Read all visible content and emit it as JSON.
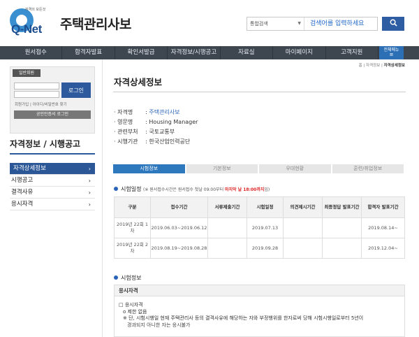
{
  "header": {
    "logo_sub": "자격의 모든것",
    "logo_text": "Q-Net",
    "site_title": "주택관리사보",
    "search_scope": "통합검색",
    "search_placeholder": "검색어를 입력하세요",
    "search_icon": "magnifier-icon"
  },
  "nav": {
    "items": [
      "원서접수",
      "합격자발표",
      "확인서발급",
      "자격정보/시행공고",
      "자료실",
      "마이페이지",
      "고객지원"
    ],
    "all_menu": "전체메뉴"
  },
  "login": {
    "title": "일반회원",
    "button": "로그인",
    "links": "회원가입 | 아이디/비밀번호 찾기",
    "cert_button": "공인인증서 로그인"
  },
  "sidebar": {
    "section_title": "자격정보 / 시행공고",
    "items": [
      {
        "label": "자격상세정보",
        "active": true
      },
      {
        "label": "시행공고"
      },
      {
        "label": "결격사유"
      },
      {
        "label": "응시자격"
      }
    ]
  },
  "content": {
    "breadcrumb_home": "홈",
    "breadcrumb_mid": "자격정보",
    "breadcrumb_current": "자격상세정보",
    "page_title": "자격상세정보",
    "info": {
      "name_label": "자격명",
      "name_value": "주택관리사보",
      "eng_label": "영문명",
      "eng_value": "Housing Manager",
      "dept_label": "관련부처",
      "dept_value": "국토교통부",
      "agency_label": "시행기관",
      "agency_value": "한국산업인력공단"
    },
    "tabs": [
      "시험정보",
      "기본정보",
      "우대현황",
      "훈련/취업정보"
    ],
    "schedule_title": "시험일정",
    "schedule_note": "(※ 원서접수시간은 원서접수 첫날 09:00부터 ",
    "schedule_note_red": "마지막 날 18:00까지",
    "schedule_note_end": "임)",
    "table": {
      "headers": [
        "구분",
        "접수기간",
        "서류제출기간",
        "시험일정",
        "의견제시기간",
        "최종정답 발표기간",
        "합격자 발표기간"
      ],
      "rows": [
        [
          "2019년 22회 1차",
          "2019.06.03~2019.06.12",
          "",
          "2019.07.13",
          "",
          "",
          "2019.08.14~"
        ],
        [
          "2019년 22회 2차",
          "2019.08.19~2019.08.28",
          "",
          "2019.09.28",
          "",
          "",
          "2019.12.04~"
        ]
      ]
    },
    "exam_info_title": "시험정보",
    "qual": {
      "head": "응시자격",
      "line1": "□ 응시자격",
      "line2": "o 제한 없음",
      "line3": "※ 단, 시험시행일 현재 주택관리사 등의 결격사유에 해당하는 자와 부정행위를 한자로써 당해 시험시행일로부터 5년이",
      "line4": "경과되지 아니한 자는 응시불가"
    }
  }
}
